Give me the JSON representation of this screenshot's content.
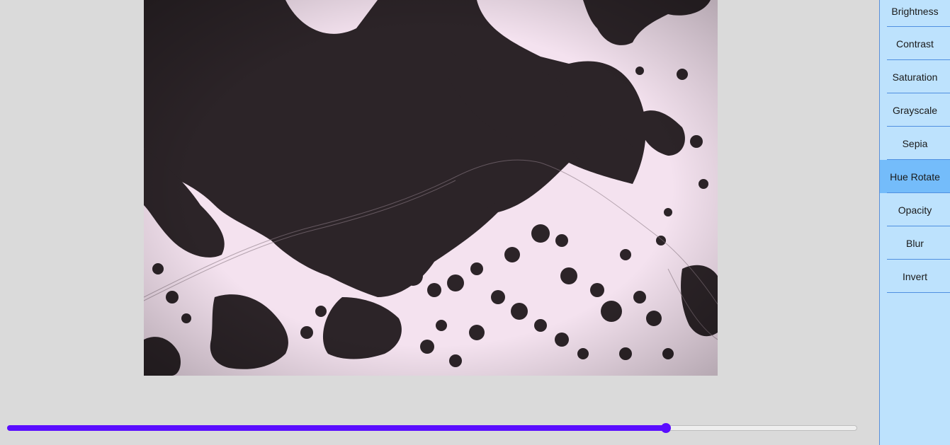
{
  "sidebar": {
    "active_index": 5,
    "items": [
      {
        "label": "Brightness"
      },
      {
        "label": "Contrast"
      },
      {
        "label": "Saturation"
      },
      {
        "label": "Grayscale"
      },
      {
        "label": "Sepia"
      },
      {
        "label": "Hue Rotate"
      },
      {
        "label": "Opacity"
      },
      {
        "label": "Blur"
      },
      {
        "label": "Invert"
      }
    ]
  },
  "slider": {
    "value_fraction": 0.775
  },
  "colors": {
    "accent": "#5a0dff",
    "sidebar_bg": "#bde2fd",
    "active_item_bg": "#74bcfa",
    "page_bg": "#dadada"
  }
}
